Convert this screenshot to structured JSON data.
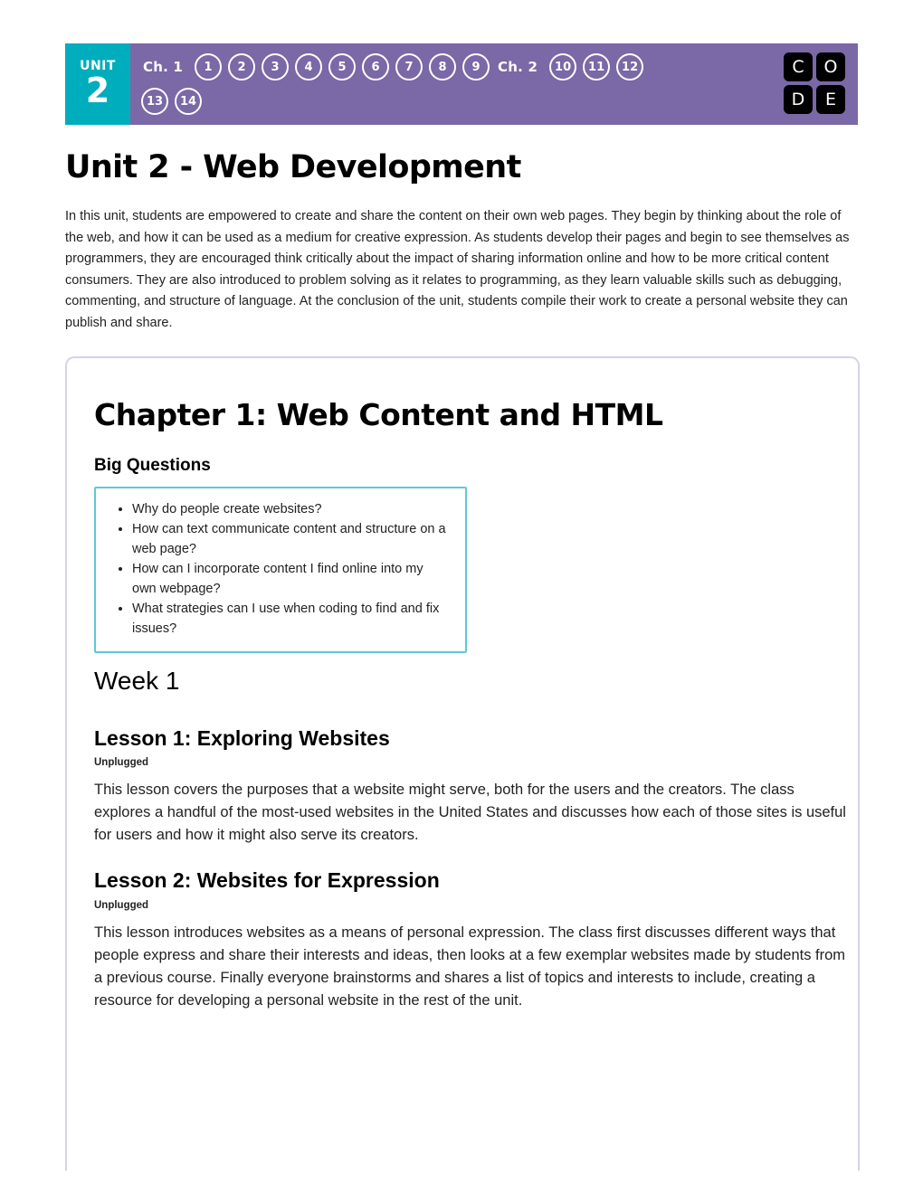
{
  "header": {
    "unit_label": "UNIT",
    "unit_number": "2",
    "chapter1_label": "Ch. 1",
    "chapter2_label": "Ch. 2",
    "chips_row1_group1": [
      "1",
      "2",
      "3",
      "4",
      "5",
      "6",
      "7",
      "8",
      "9"
    ],
    "chips_row1_group2": [
      "10",
      "11",
      "12"
    ],
    "chips_row2": [
      "13",
      "14"
    ],
    "logo_tiles": [
      "C",
      "O",
      "D",
      "E"
    ],
    "colors": {
      "unit_badge_teal": "#00ADBC",
      "nav_purple": "#7B68A6",
      "logo_black": "#000000",
      "chip_white": "#FFFFFF"
    }
  },
  "page": {
    "title": "Unit 2 - Web Development",
    "intro": "In this unit, students are empowered to create and share the content on their own web pages. They begin by thinking about the role of the web, and how it can be used as a medium for creative expression. As students develop their pages and begin to see themselves as programmers, they are encouraged think critically about the impact of sharing information online and how to be more critical content consumers. They are also introduced to problem solving as it relates to programming, as they learn valuable skills such as debugging, commenting, and structure of language. At the conclusion of the unit, students compile their work to create a personal website they can publish and share."
  },
  "chapter": {
    "title": "Chapter 1: Web Content and HTML",
    "big_questions_heading": "Big Questions",
    "big_questions": [
      "Why do people create websites?",
      "How can text communicate content and structure on a web page?",
      "How can I incorporate content I find online into my own webpage?",
      "What strategies can I use when coding to find and fix issues?"
    ],
    "big_questions_border_color": "#5FC9D6",
    "card_border_color": "#D6D3E6",
    "week_heading": "Week 1",
    "lessons": [
      {
        "heading": "Lesson 1: Exploring Websites",
        "tag": "Unplugged",
        "body": "This lesson covers the purposes that a website might serve, both for the users and the creators. The class explores a handful of the most-used websites in the United States and discusses how each of those sites is useful for users and how it might also serve its creators."
      },
      {
        "heading": "Lesson 2: Websites for Expression",
        "tag": "Unplugged",
        "body": "This lesson introduces websites as a means of personal expression. The class first discusses different ways that people express and share their interests and ideas, then looks at a few exemplar websites made by students from a previous course. Finally everyone brainstorms and shares a list of topics and interests to include, creating a resource for developing a personal website in the rest of the unit."
      }
    ]
  }
}
